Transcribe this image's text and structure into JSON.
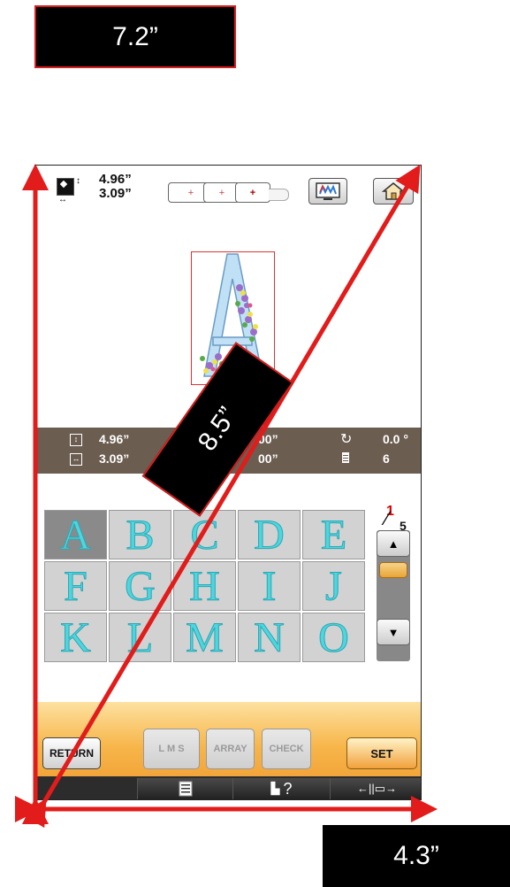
{
  "callouts": {
    "height": "7.2”",
    "width": "4.3”",
    "diagonal": "8.5”"
  },
  "topbar": {
    "design_height": "4.96”",
    "design_width": "3.09”",
    "hoop_marks": [
      "+",
      "+",
      "+"
    ],
    "icons": [
      "design-size-icon",
      "hoop-icon",
      "mw-color-icon",
      "home-icon"
    ]
  },
  "info": {
    "height": "4.96”",
    "width": "3.09”",
    "pos_v_partial": "00”",
    "pos_h_partial": "00”",
    "angle": "0.0 °",
    "colors": "6"
  },
  "patterns": {
    "letters": [
      "A",
      "B",
      "C",
      "D",
      "E",
      "F",
      "G",
      "H",
      "I",
      "J",
      "K",
      "L",
      "M",
      "N",
      "O"
    ],
    "selected": "A",
    "page": "1",
    "pages": "5"
  },
  "buttons": {
    "return": "RETURN",
    "lms": "L M S",
    "array": "ARRAY",
    "check": "CHECK",
    "set": "SET"
  },
  "navbar": {
    "help_glyph": "?",
    "move_glyph": "←||▭→"
  },
  "colors": {
    "accent_orange": "#f2a53a",
    "info_bar": "#6b5d50",
    "letter_cyan": "#4ed6df",
    "annotation_red": "#d81e1e"
  }
}
